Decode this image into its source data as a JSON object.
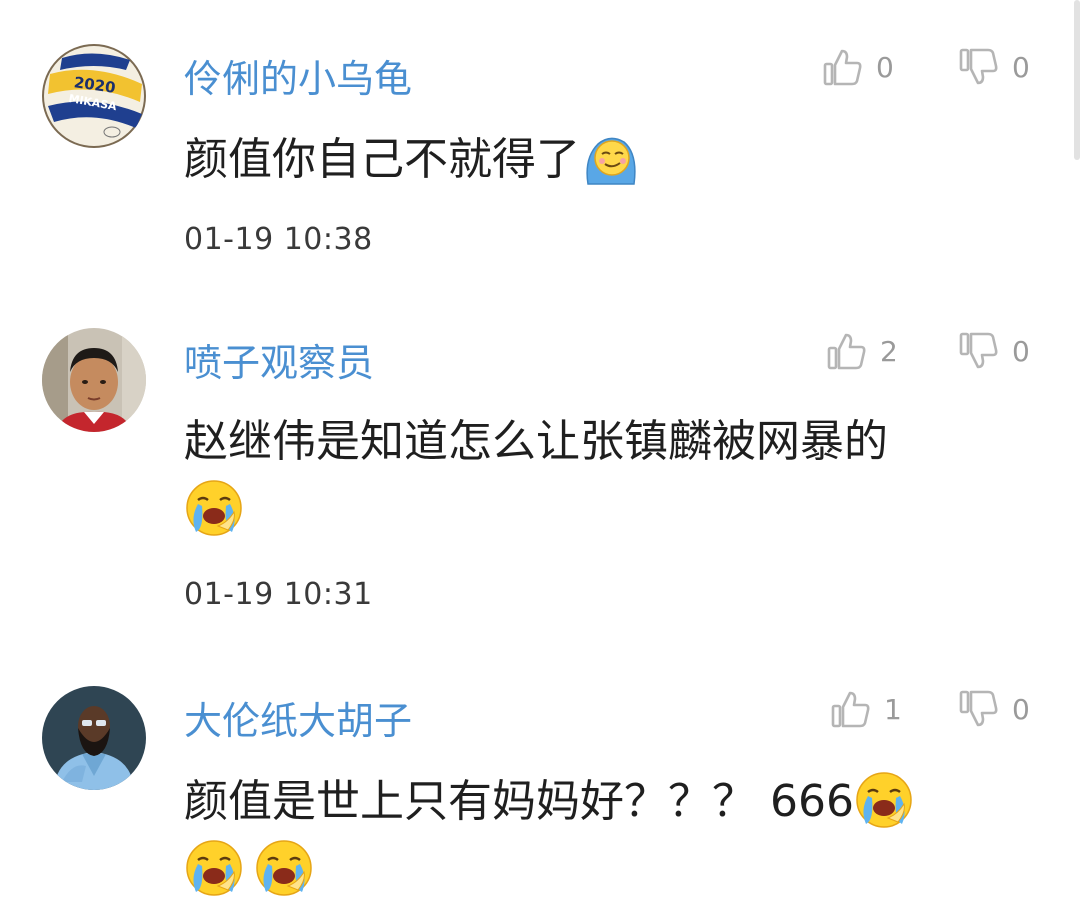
{
  "comments": [
    {
      "username": "伶俐的小乌龟",
      "content": "颜值你自己不就得了",
      "emojis_inline": [
        "smug-blanket-emoji"
      ],
      "emojis_row": [],
      "time": "01-19 10:38",
      "likes": "0",
      "dislikes": "0",
      "avatar": {
        "type": "volleyball",
        "ball_text": "2020",
        "brand": "MIKASA"
      }
    },
    {
      "username": "喷子观察员",
      "content": "赵继伟是知道怎么让张镇麟被网暴的",
      "emojis_inline": [],
      "emojis_row": [
        "crying-face-emoji"
      ],
      "time": "01-19 10:31",
      "likes": "2",
      "dislikes": "0",
      "avatar": {
        "type": "child-photo"
      }
    },
    {
      "username": "大伦纸大胡子",
      "content": "颜值是世上只有妈妈好？？？ 666",
      "emojis_inline": [
        "crying-face-emoji"
      ],
      "emojis_row": [
        "crying-face-emoji",
        "crying-face-emoji"
      ],
      "time": "",
      "likes": "1",
      "dislikes": "0",
      "avatar": {
        "type": "bearded-man-blue-suit"
      }
    }
  ],
  "colors": {
    "username": "#4a8fd1",
    "content": "#1f1f1f",
    "time": "#3a3a3a",
    "vote_count": "#9a9a9a",
    "vote_icon": "#b5b5b5"
  }
}
